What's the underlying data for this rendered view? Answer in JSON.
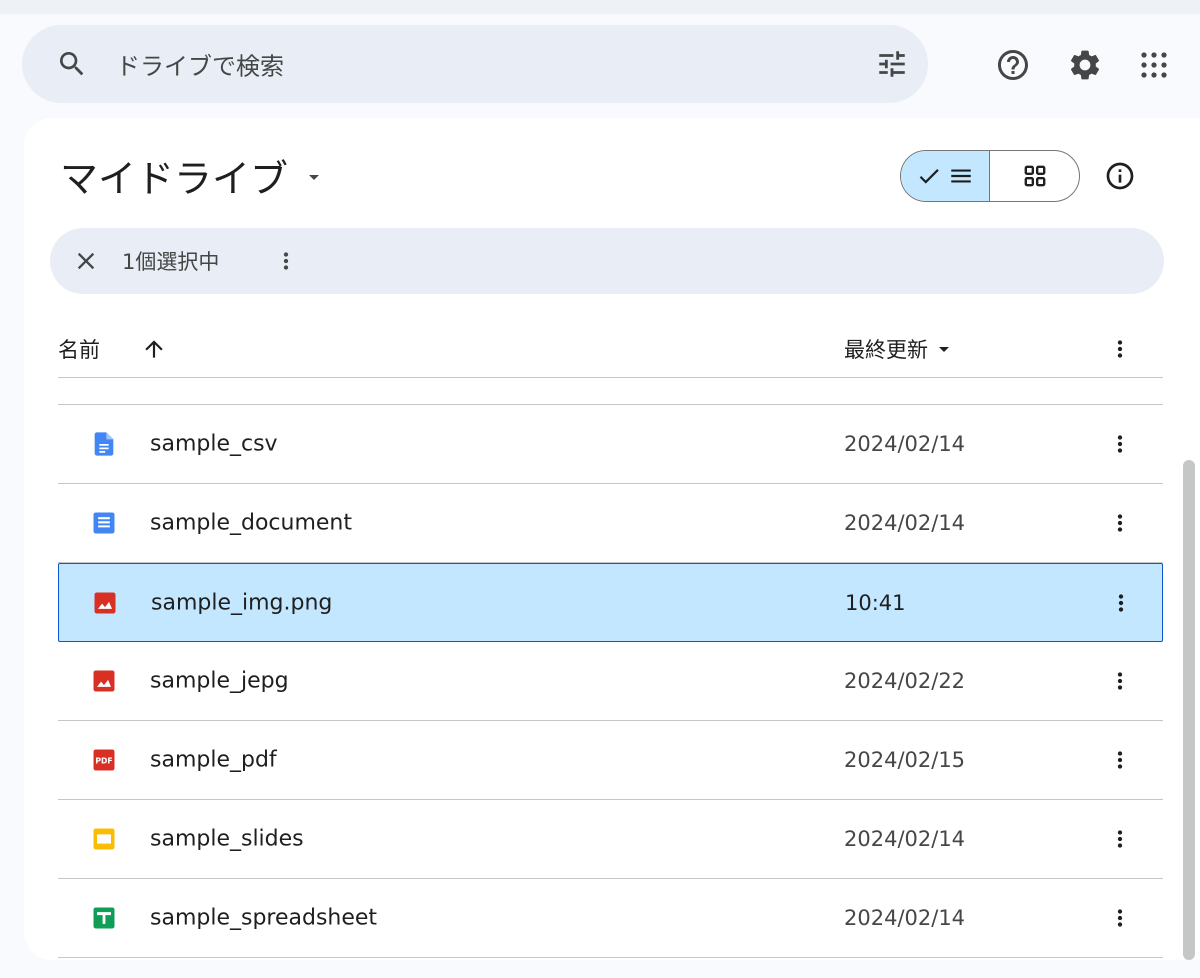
{
  "search": {
    "placeholder": "ドライブで検索"
  },
  "header": {
    "icons": [
      "help-icon",
      "settings-icon",
      "apps-grid-icon"
    ]
  },
  "title": "マイドライブ",
  "view_toggle": {
    "active": "list",
    "options": [
      "list",
      "grid"
    ]
  },
  "selection": {
    "count_label": "1個選択中"
  },
  "columns": {
    "name": "名前",
    "modified": "最終更新",
    "name_sort": "ascending"
  },
  "files": [
    {
      "name": "sample_csv",
      "modified": "2024/02/14",
      "type": "docs-file",
      "selected": false
    },
    {
      "name": "sample_document",
      "modified": "2024/02/14",
      "type": "docs",
      "selected": false
    },
    {
      "name": "sample_img.png",
      "modified": "10:41",
      "type": "image",
      "selected": true
    },
    {
      "name": "sample_jepg",
      "modified": "2024/02/22",
      "type": "image",
      "selected": false
    },
    {
      "name": "sample_pdf",
      "modified": "2024/02/15",
      "type": "pdf",
      "selected": false
    },
    {
      "name": "sample_slides",
      "modified": "2024/02/14",
      "type": "slides",
      "selected": false
    },
    {
      "name": "sample_spreadsheet",
      "modified": "2024/02/14",
      "type": "sheets",
      "selected": false
    }
  ],
  "colors": {
    "selected_bg": "#c2e7ff",
    "selected_border": "#0b57d0",
    "docs_blue": "#4285f4",
    "image_red": "#d93025",
    "slides_yellow": "#fbbc04",
    "sheets_green": "#0f9d58"
  }
}
